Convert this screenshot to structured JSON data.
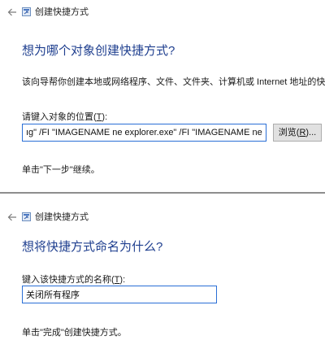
{
  "panel1": {
    "window_title": "创建快捷方式",
    "heading": "想为哪个对象创建快捷方式?",
    "description": "该向导帮你创建本地或网络程序、文件、文件夹、计算机或 Internet 地址的快捷方式。",
    "location_label_text": "请键入对象的位置(",
    "location_label_key": "T",
    "location_label_end": "):",
    "location_value": "ıg\" /FI \"IMAGENAME ne explorer.exe\" /FI \"IMAGENAME ne dwm.exe",
    "browse_label_text": "浏览(",
    "browse_label_key": "R",
    "browse_label_end": ")...",
    "hint": "单击\"下一步\"继续。"
  },
  "panel2": {
    "window_title": "创建快捷方式",
    "heading": "想将快捷方式命名为什么?",
    "name_label_text": "键入该快捷方式的名称(",
    "name_label_key": "T",
    "name_label_end": "):",
    "name_value": "关闭所有程序",
    "hint": "单击\"完成\"创建快捷方式。"
  },
  "icons": {
    "back": "back-arrow-icon",
    "app": "shortcut-wizard-icon"
  },
  "colors": {
    "heading": "#1f3f8f",
    "input_border": "#2a6fd6",
    "separator": "#8e8e8e"
  }
}
